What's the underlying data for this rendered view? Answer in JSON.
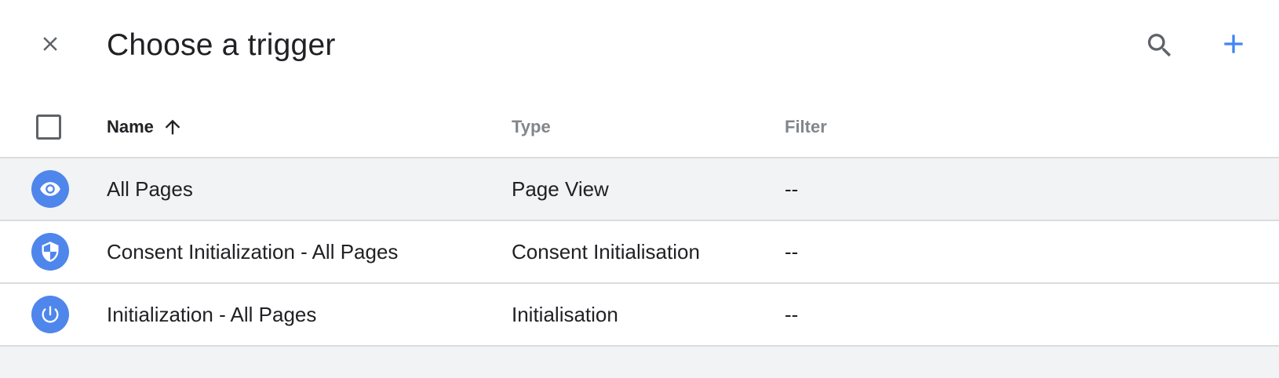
{
  "header": {
    "title": "Choose a trigger",
    "close_icon": "close-icon",
    "search_icon": "search-icon",
    "add_icon": "add-icon",
    "add_color": "#4285f4"
  },
  "table": {
    "columns": {
      "name": "Name",
      "type": "Type",
      "filter": "Filter"
    },
    "sort": "name-ascending",
    "rows": [
      {
        "icon": "eye-icon",
        "name": "All Pages",
        "type": "Page View",
        "filter": "--",
        "hovered": true
      },
      {
        "icon": "shield-icon",
        "name": "Consent Initialization - All Pages",
        "type": "Consent Initialisation",
        "filter": "--",
        "hovered": false
      },
      {
        "icon": "power-icon",
        "name": "Initialization - All Pages",
        "type": "Initialisation",
        "filter": "--",
        "hovered": false
      }
    ]
  },
  "colors": {
    "icon_circle": "#4f86ec",
    "hover_row": "#f1f3f4",
    "divider": "#dadce0"
  }
}
